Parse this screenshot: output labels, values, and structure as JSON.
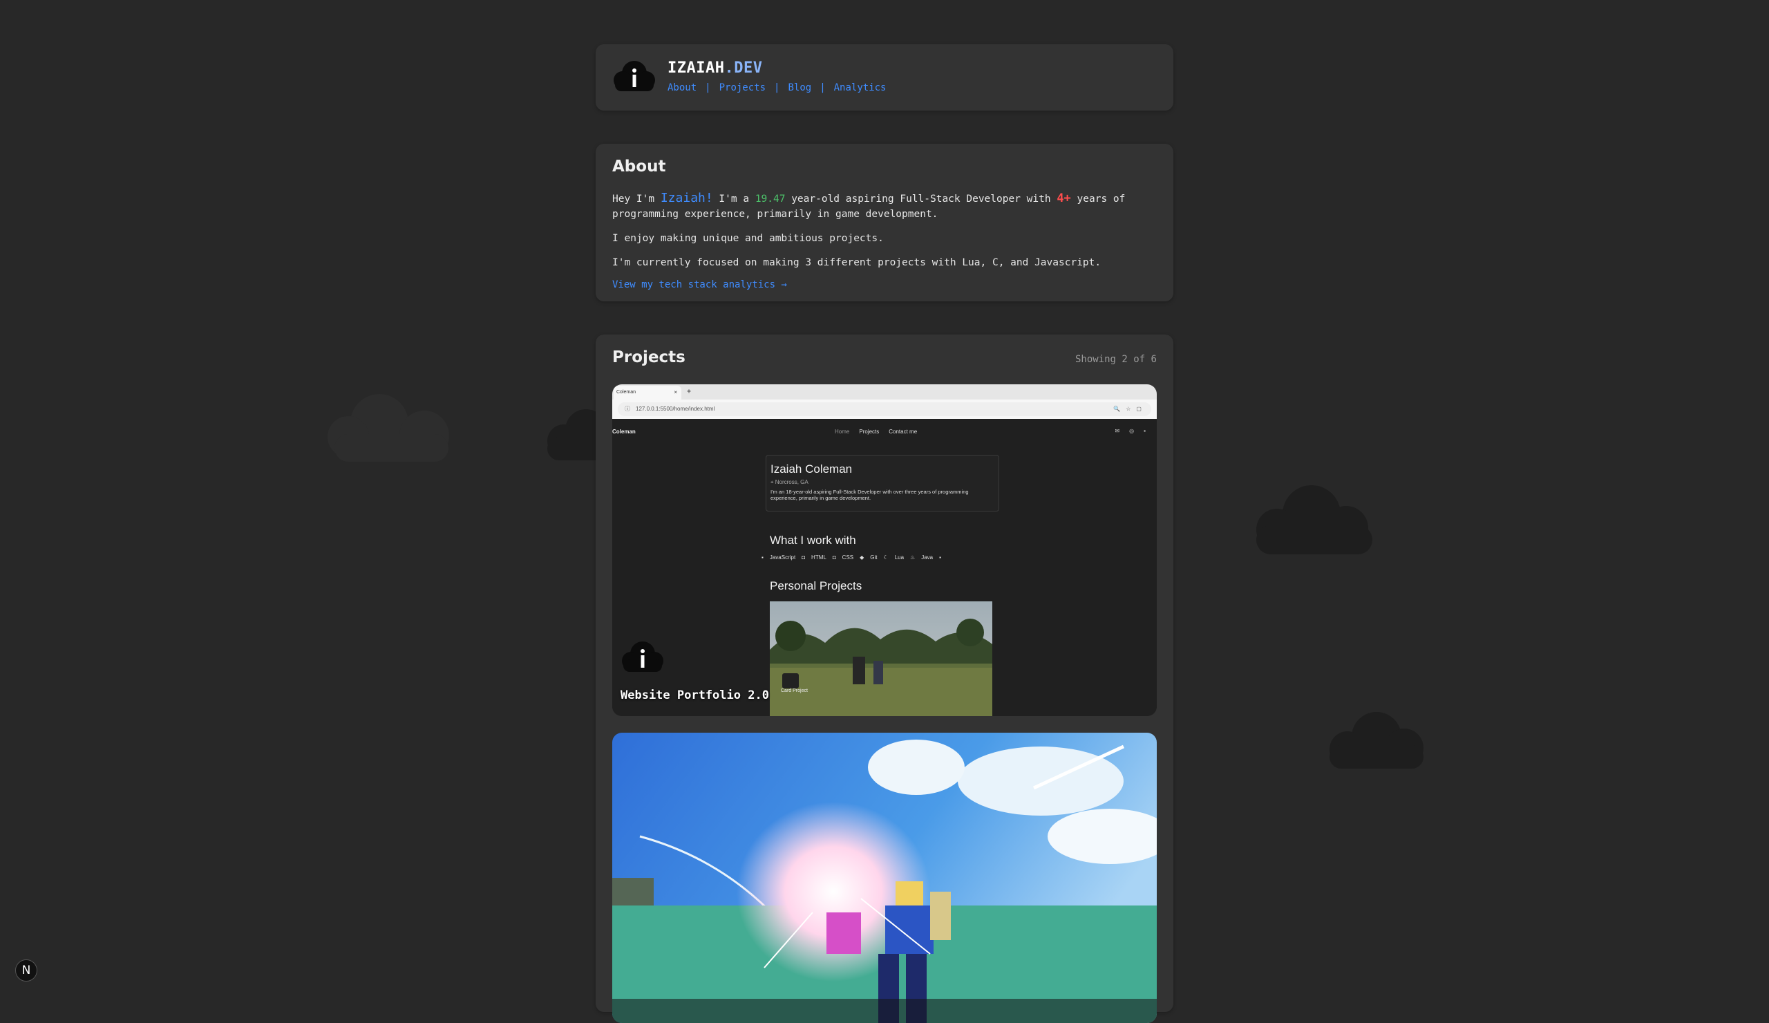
{
  "header": {
    "title_main": "IZAIAH",
    "title_accent": ".DEV",
    "nav": [
      "About",
      "Projects",
      "Blog",
      "Analytics"
    ],
    "separator": "|"
  },
  "about": {
    "heading": "About",
    "p1_a": "Hey I'm ",
    "name": "Izaiah!",
    "p1_b": " I'm a ",
    "age": "19.47",
    "p1_c": " year-old aspiring Full-Stack Developer with ",
    "years": "4+",
    "p1_d": " years of programming experience, primarily in game development.",
    "p2": "I enjoy making unique and ambitious projects.",
    "p3": "I'm currently focused on making 3 different projects with Lua, C, and Javascript.",
    "link": "View my tech stack analytics →"
  },
  "projects": {
    "heading": "Projects",
    "showing": "Showing 2 of 6",
    "items": [
      {
        "title": "Website Portfolio 2.0",
        "browser_tab": "Coleman",
        "browser_tab_close": "×",
        "browser_new_tab": "+",
        "browser_url": "127.0.0.1:5500/home/index.html",
        "site_brand": "Coleman",
        "site_nav": [
          "Home",
          "Projects",
          "Contact me"
        ],
        "profile_name": "Izaiah Coleman",
        "profile_location": "Norcross, GA",
        "profile_desc": "I'm an 18-year-old aspiring Full-Stack Developer with over three years of programming experience, primarily in game development.",
        "work_heading": "What I work with",
        "tech": [
          "JavaScript",
          "HTML",
          "CSS",
          "Git",
          "Lua",
          "Java"
        ],
        "personal_heading": "Personal Projects",
        "personal_card_label": "Card Project"
      }
    ]
  },
  "badge": "N",
  "colors": {
    "background": "#282828",
    "card": "#333333",
    "link": "#3f8cff",
    "accent_dev": "#8ab4f8",
    "age": "#4cc26a",
    "years": "#ff4d4d"
  }
}
